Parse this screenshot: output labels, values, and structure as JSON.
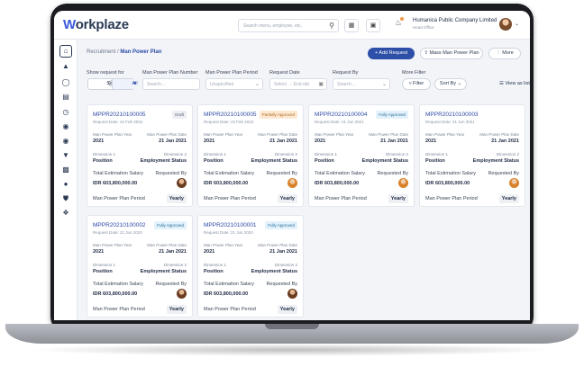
{
  "app": {
    "logo_text": "orkplaze",
    "logo_letter": "W"
  },
  "header": {
    "search_placeholder": "Search menu, employee, etc.",
    "company_name": "Humanica Public Company Limited",
    "company_sub": "Head Office"
  },
  "breadcrumb": {
    "root": "Recruitment",
    "separator": "/",
    "current": "Man Power Plan"
  },
  "actions": {
    "add_request": "+ Add Request",
    "mass_plan": "Mass Man Power Plan",
    "more": "More"
  },
  "filters": {
    "show_request_for": "Show request for",
    "self_label": "Self",
    "all_label": "All",
    "plan_number_label": "Man Power Plan Number",
    "plan_number_placeholder": "Search...",
    "plan_period_label": "Man Power Plan Period",
    "plan_period_value": "Unspecified",
    "request_date_label": "Request Date",
    "request_date_start": "Select",
    "request_date_end": "End dat",
    "request_by_label": "Request By",
    "request_by_placeholder": "Search...",
    "more_filter_label": "More Filter",
    "filter_button": "Filter",
    "sort_button": "Sort By",
    "view_as_list": "View as list"
  },
  "card_labels": {
    "plan_year": "Man Power Plan Year",
    "plan_date": "Man Power Plan Date",
    "dimension1": "Dimension 1",
    "dimension2": "Dimension 2",
    "total_salary": "Total Estimation Salary",
    "requested_by": "Requested By",
    "plan_period": "Man Power Plan Period"
  },
  "cards": [
    {
      "id": "MPPR20210100005",
      "request_date": "Request Date: 22 Feb 2022",
      "status": "Draft",
      "year": "2021",
      "date": "21 Jan 2021",
      "dim1": "Position",
      "dim2": "Employment Status",
      "salary": "IDR 603,800,000.00",
      "period": "Yearly"
    },
    {
      "id": "MPPR20210100005",
      "request_date": "Request Date: 22 Feb 2022",
      "status": "Partially Approved",
      "year": "2021",
      "date": "21 Jan 2021",
      "dim1": "Position",
      "dim2": "Employment Status",
      "salary": "IDR 603,800,000.00",
      "period": "Yearly"
    },
    {
      "id": "MPPR20210100004",
      "request_date": "Request Date: 21 Jun 2021",
      "status": "Fully Approved",
      "year": "2021",
      "date": "21 Jan 2021",
      "dim1": "Position",
      "dim2": "Employment Status",
      "salary": "IDR 603,800,000.00",
      "period": "Yearly"
    },
    {
      "id": "MPPR20210100003",
      "request_date": "Request Date: 21 Jun 2021",
      "status": "",
      "year": "2021",
      "date": "21 Jan 2021",
      "dim1": "Position",
      "dim2": "Employment Status",
      "salary": "IDR 603,800,000.00",
      "period": "Yearly"
    },
    {
      "id": "MPPR20210100002",
      "request_date": "Request Date: 21 Jun 2020",
      "status": "Fully Approved",
      "year": "2021",
      "date": "21 Jan 2021",
      "dim1": "Position",
      "dim2": "Employment Status",
      "salary": "IDR 603,800,000.00",
      "period": "Yearly"
    },
    {
      "id": "MPPR20210100001",
      "request_date": "Request Date: 21 Jun 2020",
      "status": "Fully Approved",
      "year": "2021",
      "date": "21 Jan 2021",
      "dim1": "Position",
      "dim2": "Employment Status",
      "salary": "IDR 603,800,000.00",
      "period": "Yearly"
    }
  ],
  "sidebar_icons": [
    "home-icon",
    "org-chart-icon",
    "person-icon",
    "briefcase-icon",
    "clock-icon",
    "coins-icon",
    "money-icon",
    "trophy-icon",
    "building-icon",
    "users-icon",
    "shield-icon",
    "nodes-icon"
  ]
}
